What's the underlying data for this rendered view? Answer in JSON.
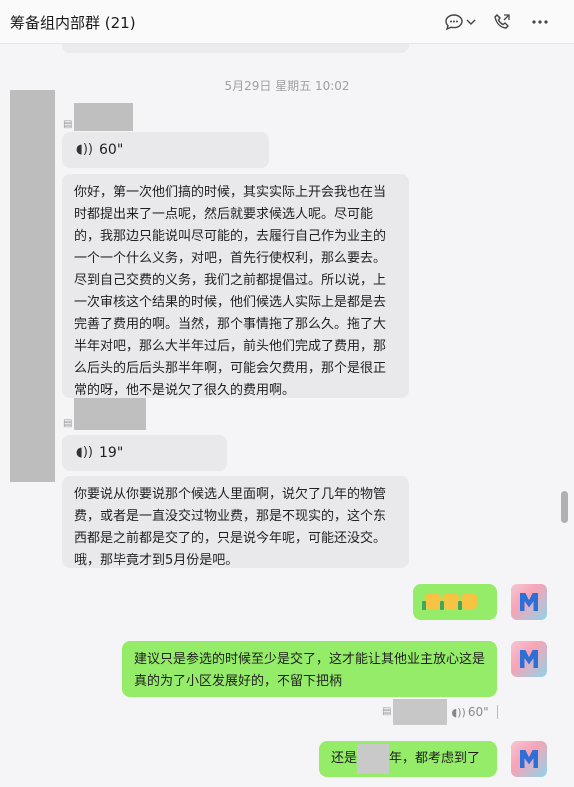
{
  "header": {
    "title": "筹备组内部群 (21)",
    "icons": [
      "chat-bubble-icon",
      "chevron-down-icon",
      "phone-icon",
      "more-icon"
    ]
  },
  "timestamp": "5月29日 星期五 10:02",
  "messages": {
    "voice1": {
      "duration": "60\""
    },
    "text1": "你好，第一次他们搞的时候，其实实际上开会我也在当时都提出来了一点呢，然后就要求候选人呢。尽可能的，我那边只能说叫尽可能的，去履行自己作为业主的一个一个什么义务，对吧，首先行使权利，那么要去。尽到自己交费的义务，我们之前都提倡过。所以说，上一次审核这个结果的时候，他们候选人实际上是都是去完善了费用的啊。当然，那个事情拖了那么久。拖了大半年对吧，那么大半年过后，前头他们完成了费用，那么后头的后后头那半年啊，可能会欠费用，那个是很正常的呀，他不是说欠了很久的费用啊。",
    "voice2": {
      "duration": "19\""
    },
    "text2": "你要说从你要说那个候选人里面啊，说欠了几年的物管费，或者是一直没交过物业费，那是不现实的，这个东西都是之前都是交了的，只是说今年呢，可能还没交。哦，那毕竟才到5月份是吧。",
    "out_text1": "建议只是参选的时候至少是交了，这才能让其他业主放心这是真的为了小区发展好的，不留下把柄",
    "out_voice": {
      "duration": "60\""
    },
    "out_text2_prefix": "还是",
    "out_text2_suffix": "年，都考虑到了"
  },
  "colors": {
    "incoming_bubble": "#e9e9ec",
    "outgoing_bubble": "#95ec69",
    "background": "#f5f5f7"
  }
}
